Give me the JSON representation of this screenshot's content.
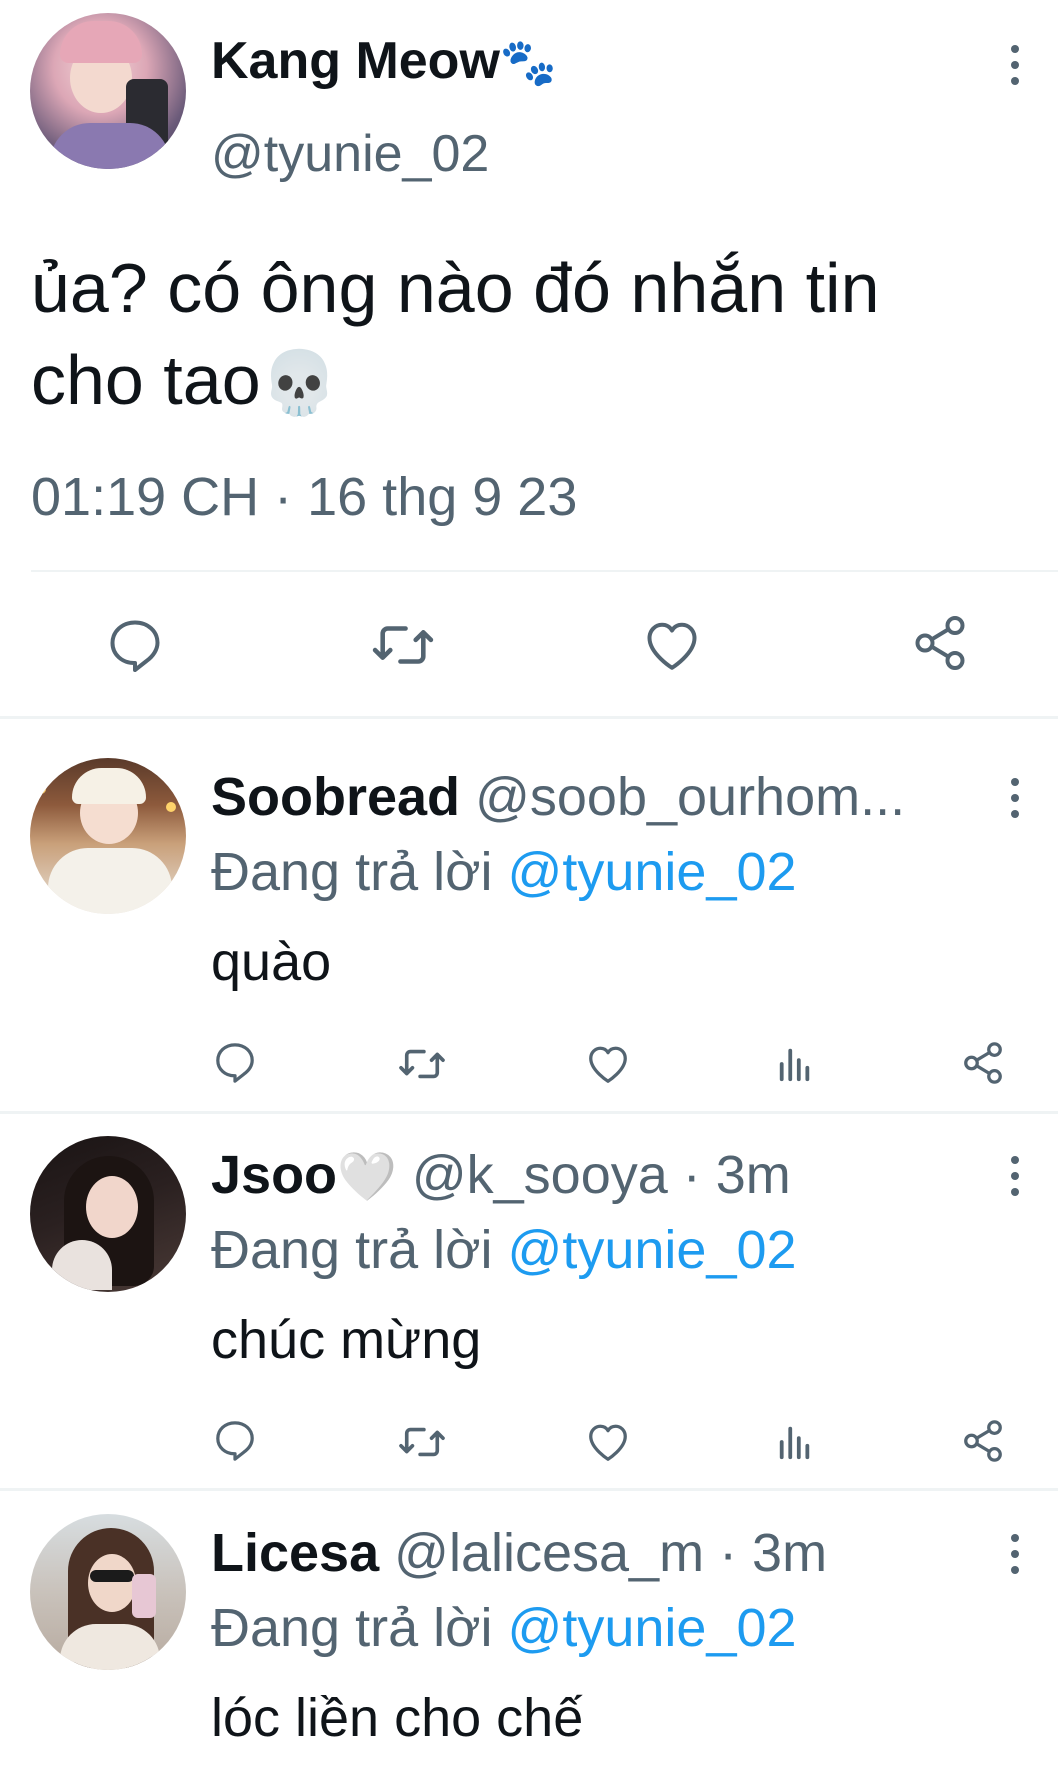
{
  "main_tweet": {
    "display_name": "Kang Meow",
    "name_emoji": "🐾",
    "handle": "@tyunie_02",
    "text_line1": "ủa? có ông nào đó nhắn tin",
    "text_line2": "cho tao",
    "text_emoji": "💀",
    "timestamp": "01:19 CH · 16 thg 9 23",
    "actions": [
      "reply-icon",
      "retweet-icon",
      "like-icon",
      "share-icon"
    ]
  },
  "replies": [
    {
      "display_name": "Soobread",
      "name_emoji": "",
      "handle": "@soob_ourhom...",
      "time": "",
      "replying_prefix": "Đang trả lời",
      "replying_to": "@tyunie_02",
      "text": "quào"
    },
    {
      "display_name": "Jsoo",
      "name_emoji": "🤍",
      "handle": "@k_sooya · 3m",
      "time": "",
      "replying_prefix": "Đang trả lời",
      "replying_to": "@tyunie_02",
      "text": "chúc mừng"
    },
    {
      "display_name": "Licesa",
      "name_emoji": "",
      "handle": "@lalicesa_m · 3m",
      "time": "",
      "replying_prefix": "Đang trả lời",
      "replying_to": "@tyunie_02",
      "text": "lóc liền cho chế"
    }
  ],
  "colors": {
    "text": "#0f1419",
    "muted": "#536471",
    "link": "#1d9bf0",
    "divider": "#eff3f4"
  }
}
